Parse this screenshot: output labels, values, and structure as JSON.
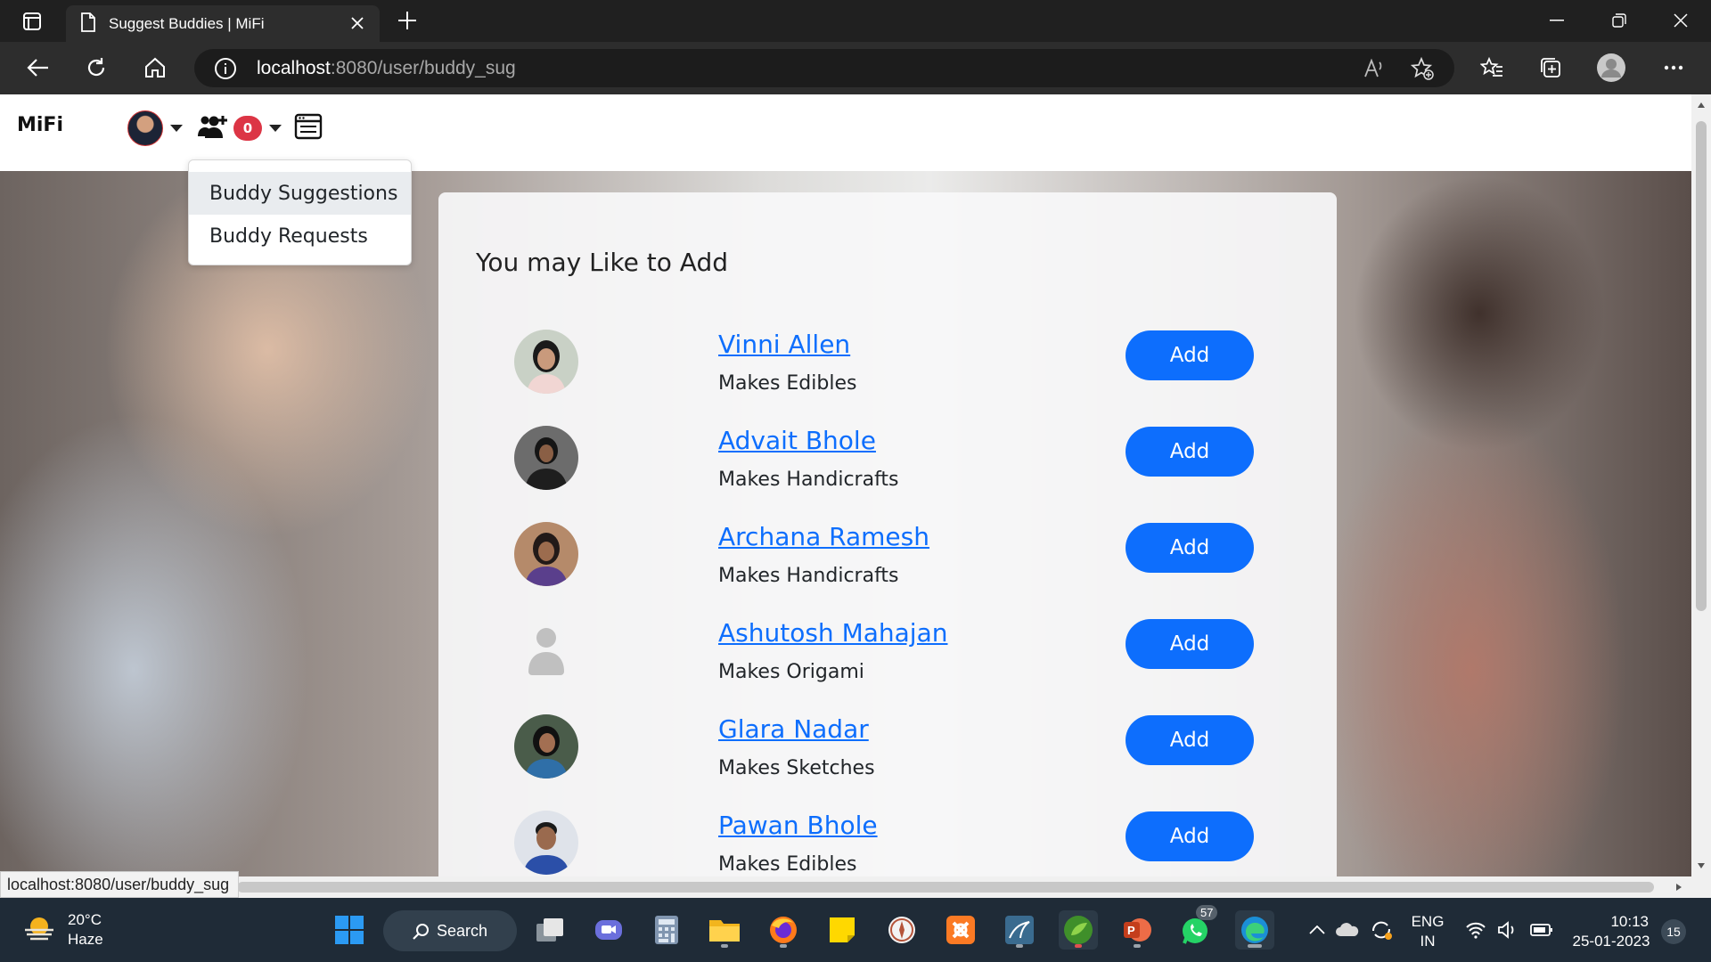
{
  "browser": {
    "tab_title": "Suggest Buddies | MiFi",
    "address_host": "localhost",
    "address_path": ":8080/user/buddy_sug",
    "status_url": "localhost:8080/user/buddy_sug"
  },
  "page": {
    "brand": "MiFi",
    "buddy_request_count": "0",
    "dropdown": {
      "items": [
        {
          "label": "Buddy Suggestions",
          "active": true
        },
        {
          "label": "Buddy Requests",
          "active": false
        }
      ]
    },
    "card_title": "You may Like to Add",
    "add_label": "Add",
    "suggestions": [
      {
        "name": "Vinni Allen",
        "skill": "Makes Edibles",
        "avatar": "photo"
      },
      {
        "name": "Advait Bhole",
        "skill": "Makes Handicrafts",
        "avatar": "photo"
      },
      {
        "name": "Archana Ramesh",
        "skill": "Makes Handicrafts",
        "avatar": "photo"
      },
      {
        "name": "Ashutosh Mahajan",
        "skill": "Makes Origami",
        "avatar": "placeholder"
      },
      {
        "name": "Glara Nadar",
        "skill": "Makes Sketches",
        "avatar": "photo"
      },
      {
        "name": "Pawan Bhole",
        "skill": "Makes Edibles",
        "avatar": "photo"
      }
    ]
  },
  "taskbar": {
    "weather_temp": "20°C",
    "weather_desc": "Haze",
    "search_label": "Search",
    "whatsapp_badge": "57",
    "lang_line1": "ENG",
    "lang_line2": "IN",
    "time": "10:13",
    "date": "25-01-2023",
    "notification_count": "15"
  },
  "colors": {
    "primary": "#0d6efd",
    "badge_red": "#dc3545",
    "chrome_dark": "#202020",
    "taskbar": "#1f2b37"
  }
}
